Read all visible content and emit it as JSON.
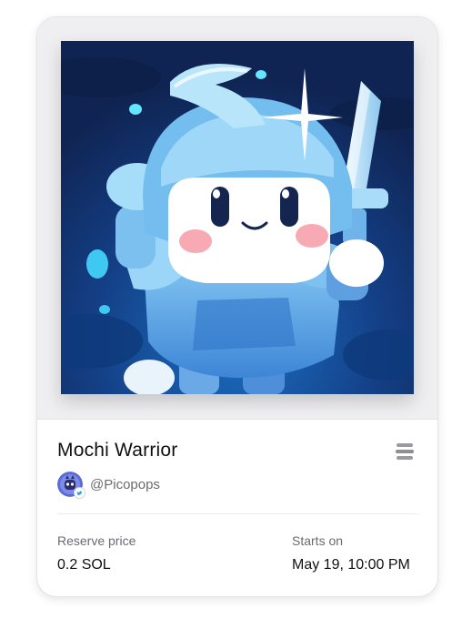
{
  "nft": {
    "title": "Mochi Warrior",
    "artwork_icon": "knight-character-artwork",
    "menu_icon": "stack-icon"
  },
  "creator": {
    "handle": "@Picopops",
    "avatar_icon": "creator-avatar",
    "badge_icon": "verified-twitter-badge-icon"
  },
  "auction": {
    "reserve_label": "Reserve price",
    "reserve_value": "0.2 SOL",
    "start_label": "Starts on",
    "start_value": "May 19, 10:00 PM"
  },
  "colors": {
    "card_border": "#e3e3e6",
    "media_background": "#efeff1",
    "muted_text": "#6b6b70",
    "art_background": "#12306b",
    "art_accent": "#5fb6ea"
  }
}
